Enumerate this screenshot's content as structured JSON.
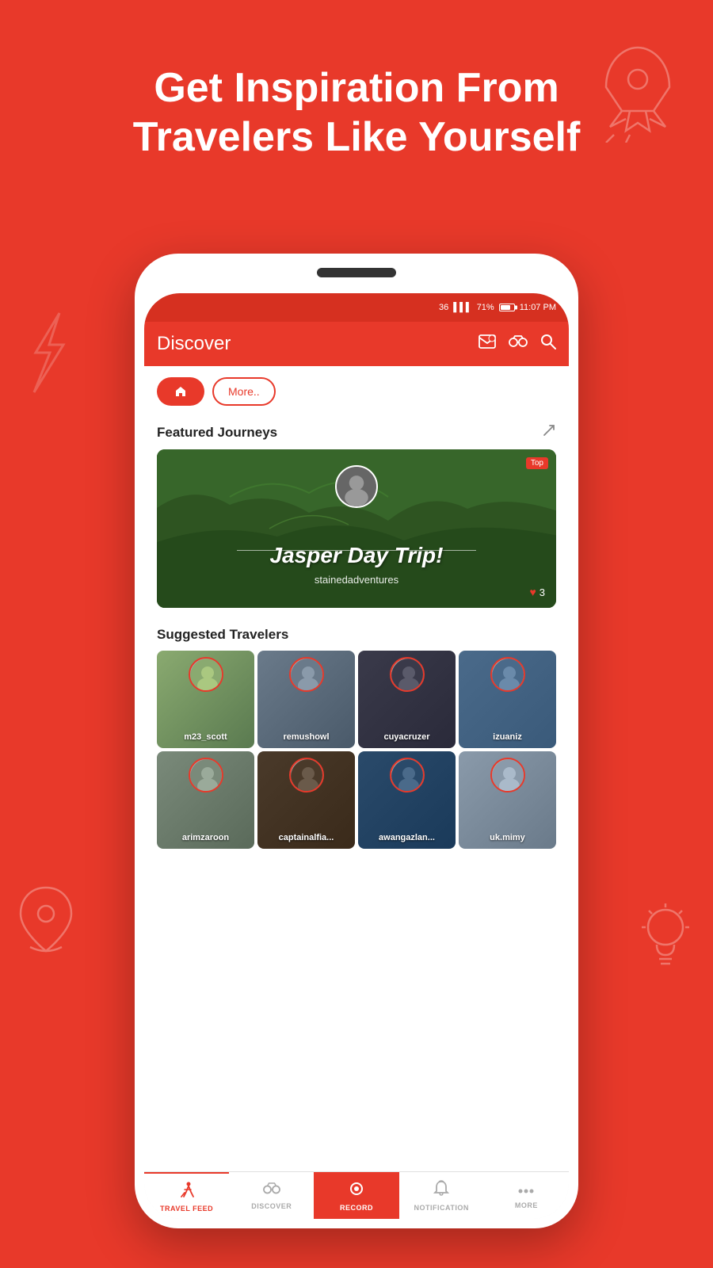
{
  "background_color": "#e8392a",
  "headline": {
    "line1": "Get Inspiration From",
    "line2": "Travelers Like Yourself"
  },
  "phone": {
    "status_bar": {
      "signal": "36",
      "battery": "71%",
      "time": "11:07 PM"
    },
    "header": {
      "title": "Discover",
      "icons": [
        "envelope-icon",
        "binoculars-icon",
        "search-icon"
      ]
    },
    "filter_buttons": [
      {
        "label": "🏠",
        "type": "home",
        "active": true
      },
      {
        "label": "More..",
        "type": "more",
        "active": false
      }
    ],
    "featured_section": {
      "title": "Featured Journeys",
      "journey": {
        "title": "Jasper Day Trip!",
        "username": "stainedadventures",
        "likes": 3,
        "tag": "Top"
      }
    },
    "suggested_section": {
      "title": "Suggested Travelers",
      "travelers": [
        {
          "name": "m23_scott",
          "color_class": "tc1"
        },
        {
          "name": "remushowl",
          "color_class": "tc2"
        },
        {
          "name": "cuyacruzer",
          "color_class": "tc3"
        },
        {
          "name": "izuaniz",
          "color_class": "tc4"
        },
        {
          "name": "arimzaroon",
          "color_class": "tc5"
        },
        {
          "name": "captainalfia...",
          "color_class": "tc6"
        },
        {
          "name": "awangazlan...",
          "color_class": "tc7"
        },
        {
          "name": "uk.mimy",
          "color_class": "tc8"
        }
      ]
    },
    "bottom_nav": [
      {
        "id": "travel-feed",
        "label": "TRAVEL FEED",
        "icon": "hiker-icon",
        "active": true
      },
      {
        "id": "discover",
        "label": "DISCOVER",
        "icon": "binoculars-nav-icon",
        "active": false
      },
      {
        "id": "record",
        "label": "RECORD",
        "icon": "record-icon",
        "active": false
      },
      {
        "id": "notification",
        "label": "NOTIFICATION",
        "icon": "bell-icon",
        "active": false
      },
      {
        "id": "more",
        "label": "MORE",
        "icon": "dots-icon",
        "active": false
      }
    ]
  }
}
